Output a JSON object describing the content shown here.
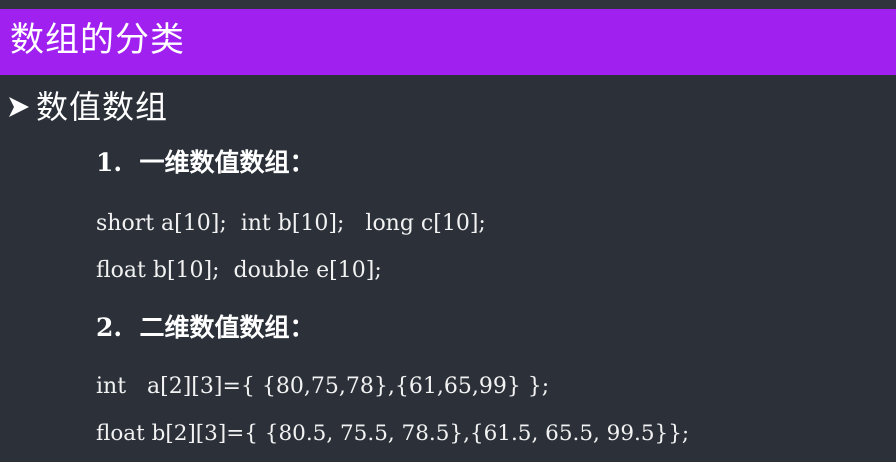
{
  "slide": {
    "title": "数组的分类",
    "bullet": "数值数组",
    "section1_heading": "1.  一维数值数组：",
    "code_line1": "short a[10];  int b[10];   long c[10];",
    "code_line2": "float b[10];  double e[10];",
    "section2_heading": "2.  二维数值数组：",
    "code_line3": "int   a[2][3]={ {80,75,78},{61,65,99} };",
    "code_line4": "float b[2][3]={ {80.5, 75.5, 78.5},{61.5, 65.5, 99.5}};"
  },
  "colors": {
    "title_band": "#a020f0",
    "background": "#2b3039",
    "text": "#ffffff"
  },
  "icons": {
    "bullet": "arrowhead-right-icon"
  }
}
